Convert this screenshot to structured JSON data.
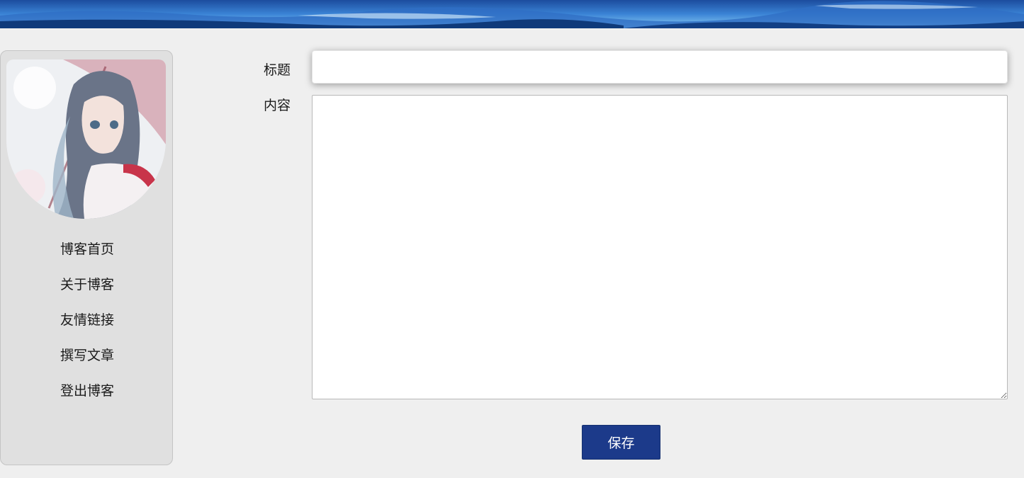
{
  "header": {
    "banner_image": "mountain-landscape-banner"
  },
  "sidebar": {
    "avatar_image": "anime-girl-with-umbrella-avatar",
    "items": [
      {
        "label": "博客首页"
      },
      {
        "label": "关于博客"
      },
      {
        "label": "友情链接"
      },
      {
        "label": "撰写文章"
      },
      {
        "label": "登出博客"
      }
    ]
  },
  "form": {
    "title_label": "标题",
    "title_value": "",
    "content_label": "内容",
    "content_value": "",
    "save_label": "保存"
  },
  "colors": {
    "background": "#efefef",
    "sidebar_bg": "#e0e0e0",
    "button_bg": "#1c3a8a",
    "button_text": "#ffffff"
  }
}
